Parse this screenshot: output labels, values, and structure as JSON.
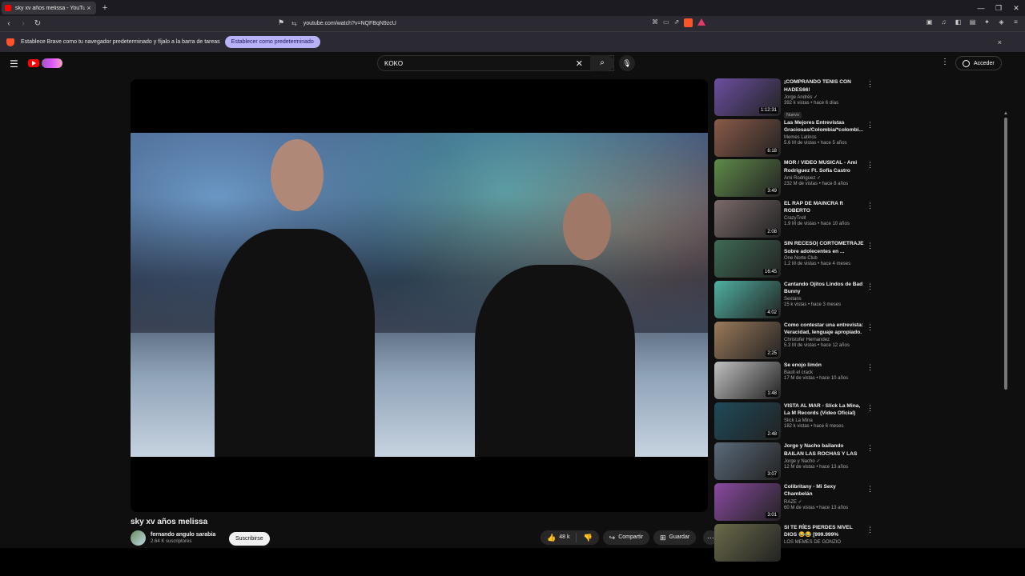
{
  "browser": {
    "tab_title": "sky xv años melissa - YouTube",
    "tab_close": "×",
    "new_tab": "+",
    "url": "youtube.com/watch?v=NQFBqN9zcU",
    "infobar_text": "Establece Brave como tu navegador predeterminado y fíjalo a la barra de tareas",
    "infobar_button": "Establecer como predeterminado",
    "infobar_close": "×",
    "win_min": "—",
    "win_max": "❐",
    "win_close": "✕"
  },
  "youtube": {
    "search_value": "KOKO",
    "signin_label": "Acceder",
    "video_title": "sky xv años melissa",
    "channel_name": "fernando angulo sarabia",
    "channel_subs": "2.64 K suscriptores",
    "subscribe_label": "Suscribirse",
    "like_count": "48 k",
    "share_label": "Compartir",
    "save_label": "Guardar"
  },
  "recommendations": [
    {
      "title": "¡COMPRANDO TENIS CON HADES66!",
      "channel": "Jorge Andrés ✓",
      "meta": "392 k vistas • hace 6 días",
      "duration": "1:12:31",
      "badge": "Nuevo",
      "color": "#6b4fa0"
    },
    {
      "title": "Las Mejores Entrevistas Graciosas/Colombia/*colombi...",
      "channel": "Memes Latinos",
      "meta": "5.6 M de vistas • hace 5 años",
      "duration": "6:18",
      "badge": "",
      "color": "#8a5a48"
    },
    {
      "title": "MOR / VIDEO MUSICAL - Ami Rodriguez Ft. Sofia Castro",
      "channel": "Ami Rodriguez ✓",
      "meta": "232 M de vistas • hace 8 años",
      "duration": "3:49",
      "badge": "",
      "color": "#5f8a4a"
    },
    {
      "title": "EL RAP DE MAINCRA ft ROBERTO",
      "channel": "CrazyTroll",
      "meta": "1.9 M de vistas • hace 10 años",
      "duration": "2:08",
      "badge": "",
      "color": "#7a6a6a"
    },
    {
      "title": "SIN RECESO| CORTOMETRAJE Sobre adolecentes en ...",
      "channel": "One Norte Club",
      "meta": "1.2 M de vistas • hace 4 meses",
      "duration": "16:45",
      "badge": "",
      "color": "#3f6a55"
    },
    {
      "title": "Cantando Ojitos Lindos de Bad Bunny",
      "channel": "Sextans",
      "meta": "15 k vistas • hace 3 meses",
      "duration": "4:02",
      "badge": "",
      "color": "#4fb0a0"
    },
    {
      "title": "Como contestar una entrevista: Veracidad, lenguaje apropiado.",
      "channel": "Christofer Hernandez",
      "meta": "5.3 M de vistas • hace 12 años",
      "duration": "2:25",
      "badge": "",
      "color": "#9a7a5a"
    },
    {
      "title": "Se enojo limón",
      "channel": "Bauti el crack",
      "meta": "17 M de vistas • hace 10 años",
      "duration": "1:48",
      "badge": "",
      "color": "#c0c0c0"
    },
    {
      "title": "VISTA AL MAR - Slick La Mina, La M Records (Video Oficial)",
      "channel": "Slick La Mina",
      "meta": "182 k vistas • hace 6 meses",
      "duration": "2:48",
      "badge": "",
      "color": "#1f4a5a"
    },
    {
      "title": "Jorge y Nacho bailando BAILAN LAS ROCHAS Y LAS CHETAS -...",
      "channel": "Jorge y Nacho ✓",
      "meta": "12 M de vistas • hace 13 años",
      "duration": "3:07",
      "badge": "",
      "color": "#5a6a7a"
    },
    {
      "title": "Colibritany - Mi Sexy Chambelán",
      "channel": "RAZE ✓",
      "meta": "60 M de vistas • hace 13 años",
      "duration": "3:01",
      "badge": "",
      "color": "#8a4aa0"
    },
    {
      "title": "SI TE RÍES PIERDES NIVEL DIOS 😂😂 [999.999% IMPOSIBLE ...",
      "channel": "LOS MEMES DE GONZIO",
      "meta": "",
      "duration": "",
      "badge": "",
      "color": "#6a6a4a"
    }
  ]
}
